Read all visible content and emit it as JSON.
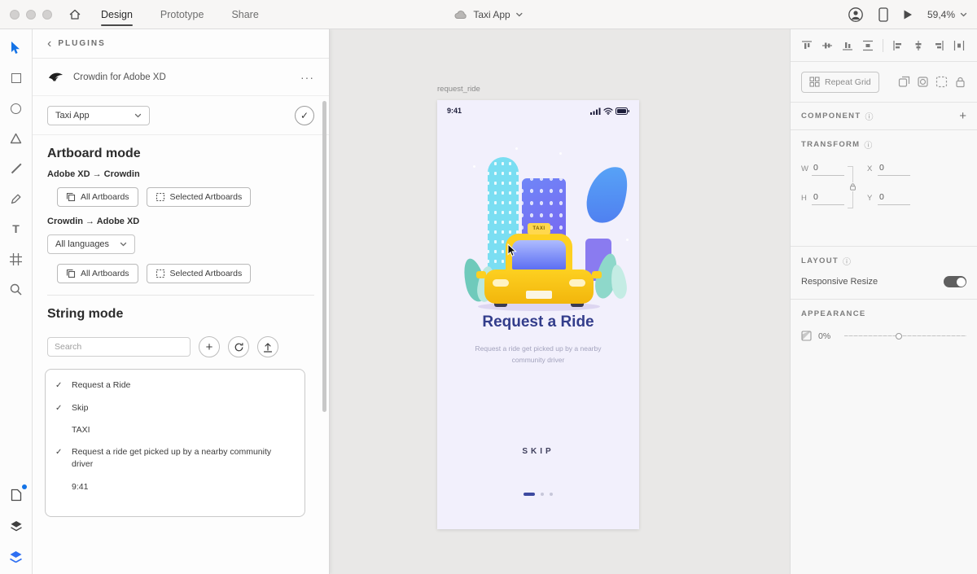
{
  "titlebar": {
    "tabs": [
      {
        "label": "Design"
      },
      {
        "label": "Prototype"
      },
      {
        "label": "Share"
      }
    ],
    "document_title": "Taxi App",
    "zoom_level": "59,4%"
  },
  "icons": {
    "back_chevron": "‹",
    "overflow_menu": "···",
    "check": "✓",
    "plus": "+",
    "info": "ⓘ",
    "text_tool": "T"
  },
  "plugin": {
    "header": "PLUGINS",
    "name": "Crowdin for Adobe XD",
    "project_select": "Taxi App",
    "artboard_mode": {
      "title": "Artboard mode",
      "direction_down": "Adobe XD → Crowdin",
      "all_artboards": "All Artboards",
      "selected_artboards": "Selected Artboards",
      "direction_up": "Crowdin → Adobe XD",
      "language_select": "All languages"
    },
    "string_mode": {
      "title": "String mode",
      "search_placeholder": "Search",
      "strings": [
        {
          "checked": true,
          "text": "Request a Ride"
        },
        {
          "checked": true,
          "text": "Skip"
        },
        {
          "checked": false,
          "text": "TAXI"
        },
        {
          "checked": true,
          "text": "Request a ride get picked up by a nearby community driver"
        },
        {
          "checked": false,
          "text": "9:41"
        }
      ]
    }
  },
  "canvas": {
    "artboard_label": "request_ride",
    "phone": {
      "status_time": "9:41",
      "taxi_sign": "TAXI",
      "title": "Request a Ride",
      "subtitle": "Request a ride get picked up by a nearby community driver",
      "skip_label": "SKIP"
    }
  },
  "inspector": {
    "repeat_grid": "Repeat Grid",
    "component": {
      "title": "COMPONENT"
    },
    "transform": {
      "title": "TRANSFORM",
      "w_label": "W",
      "h_label": "H",
      "x_label": "X",
      "y_label": "Y",
      "w": "0",
      "h": "0",
      "x": "0",
      "y": "0"
    },
    "layout": {
      "title": "LAYOUT",
      "responsive_resize": "Responsive Resize",
      "responsive_resize_enabled": true
    },
    "appearance": {
      "title": "APPEARANCE",
      "opacity": "0%"
    }
  },
  "colors": {
    "accent_blue": "#1473e6",
    "taxi_yellow": "#f9c513",
    "title_navy": "#333d8b",
    "canvas_gray": "#e9e8e7"
  }
}
